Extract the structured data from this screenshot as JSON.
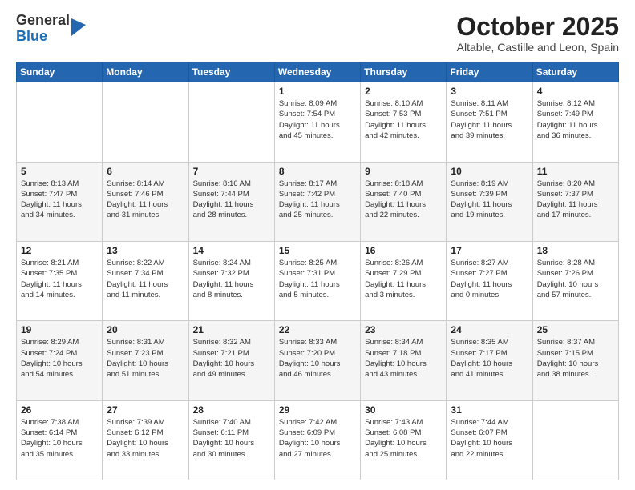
{
  "logo": {
    "general": "General",
    "blue": "Blue"
  },
  "header": {
    "month": "October 2025",
    "location": "Altable, Castille and Leon, Spain"
  },
  "weekdays": [
    "Sunday",
    "Monday",
    "Tuesday",
    "Wednesday",
    "Thursday",
    "Friday",
    "Saturday"
  ],
  "weeks": [
    [
      {
        "day": "",
        "info": ""
      },
      {
        "day": "",
        "info": ""
      },
      {
        "day": "",
        "info": ""
      },
      {
        "day": "1",
        "info": "Sunrise: 8:09 AM\nSunset: 7:54 PM\nDaylight: 11 hours\nand 45 minutes."
      },
      {
        "day": "2",
        "info": "Sunrise: 8:10 AM\nSunset: 7:53 PM\nDaylight: 11 hours\nand 42 minutes."
      },
      {
        "day": "3",
        "info": "Sunrise: 8:11 AM\nSunset: 7:51 PM\nDaylight: 11 hours\nand 39 minutes."
      },
      {
        "day": "4",
        "info": "Sunrise: 8:12 AM\nSunset: 7:49 PM\nDaylight: 11 hours\nand 36 minutes."
      }
    ],
    [
      {
        "day": "5",
        "info": "Sunrise: 8:13 AM\nSunset: 7:47 PM\nDaylight: 11 hours\nand 34 minutes."
      },
      {
        "day": "6",
        "info": "Sunrise: 8:14 AM\nSunset: 7:46 PM\nDaylight: 11 hours\nand 31 minutes."
      },
      {
        "day": "7",
        "info": "Sunrise: 8:16 AM\nSunset: 7:44 PM\nDaylight: 11 hours\nand 28 minutes."
      },
      {
        "day": "8",
        "info": "Sunrise: 8:17 AM\nSunset: 7:42 PM\nDaylight: 11 hours\nand 25 minutes."
      },
      {
        "day": "9",
        "info": "Sunrise: 8:18 AM\nSunset: 7:40 PM\nDaylight: 11 hours\nand 22 minutes."
      },
      {
        "day": "10",
        "info": "Sunrise: 8:19 AM\nSunset: 7:39 PM\nDaylight: 11 hours\nand 19 minutes."
      },
      {
        "day": "11",
        "info": "Sunrise: 8:20 AM\nSunset: 7:37 PM\nDaylight: 11 hours\nand 17 minutes."
      }
    ],
    [
      {
        "day": "12",
        "info": "Sunrise: 8:21 AM\nSunset: 7:35 PM\nDaylight: 11 hours\nand 14 minutes."
      },
      {
        "day": "13",
        "info": "Sunrise: 8:22 AM\nSunset: 7:34 PM\nDaylight: 11 hours\nand 11 minutes."
      },
      {
        "day": "14",
        "info": "Sunrise: 8:24 AM\nSunset: 7:32 PM\nDaylight: 11 hours\nand 8 minutes."
      },
      {
        "day": "15",
        "info": "Sunrise: 8:25 AM\nSunset: 7:31 PM\nDaylight: 11 hours\nand 5 minutes."
      },
      {
        "day": "16",
        "info": "Sunrise: 8:26 AM\nSunset: 7:29 PM\nDaylight: 11 hours\nand 3 minutes."
      },
      {
        "day": "17",
        "info": "Sunrise: 8:27 AM\nSunset: 7:27 PM\nDaylight: 11 hours\nand 0 minutes."
      },
      {
        "day": "18",
        "info": "Sunrise: 8:28 AM\nSunset: 7:26 PM\nDaylight: 10 hours\nand 57 minutes."
      }
    ],
    [
      {
        "day": "19",
        "info": "Sunrise: 8:29 AM\nSunset: 7:24 PM\nDaylight: 10 hours\nand 54 minutes."
      },
      {
        "day": "20",
        "info": "Sunrise: 8:31 AM\nSunset: 7:23 PM\nDaylight: 10 hours\nand 51 minutes."
      },
      {
        "day": "21",
        "info": "Sunrise: 8:32 AM\nSunset: 7:21 PM\nDaylight: 10 hours\nand 49 minutes."
      },
      {
        "day": "22",
        "info": "Sunrise: 8:33 AM\nSunset: 7:20 PM\nDaylight: 10 hours\nand 46 minutes."
      },
      {
        "day": "23",
        "info": "Sunrise: 8:34 AM\nSunset: 7:18 PM\nDaylight: 10 hours\nand 43 minutes."
      },
      {
        "day": "24",
        "info": "Sunrise: 8:35 AM\nSunset: 7:17 PM\nDaylight: 10 hours\nand 41 minutes."
      },
      {
        "day": "25",
        "info": "Sunrise: 8:37 AM\nSunset: 7:15 PM\nDaylight: 10 hours\nand 38 minutes."
      }
    ],
    [
      {
        "day": "26",
        "info": "Sunrise: 7:38 AM\nSunset: 6:14 PM\nDaylight: 10 hours\nand 35 minutes."
      },
      {
        "day": "27",
        "info": "Sunrise: 7:39 AM\nSunset: 6:12 PM\nDaylight: 10 hours\nand 33 minutes."
      },
      {
        "day": "28",
        "info": "Sunrise: 7:40 AM\nSunset: 6:11 PM\nDaylight: 10 hours\nand 30 minutes."
      },
      {
        "day": "29",
        "info": "Sunrise: 7:42 AM\nSunset: 6:09 PM\nDaylight: 10 hours\nand 27 minutes."
      },
      {
        "day": "30",
        "info": "Sunrise: 7:43 AM\nSunset: 6:08 PM\nDaylight: 10 hours\nand 25 minutes."
      },
      {
        "day": "31",
        "info": "Sunrise: 7:44 AM\nSunset: 6:07 PM\nDaylight: 10 hours\nand 22 minutes."
      },
      {
        "day": "",
        "info": ""
      }
    ]
  ]
}
